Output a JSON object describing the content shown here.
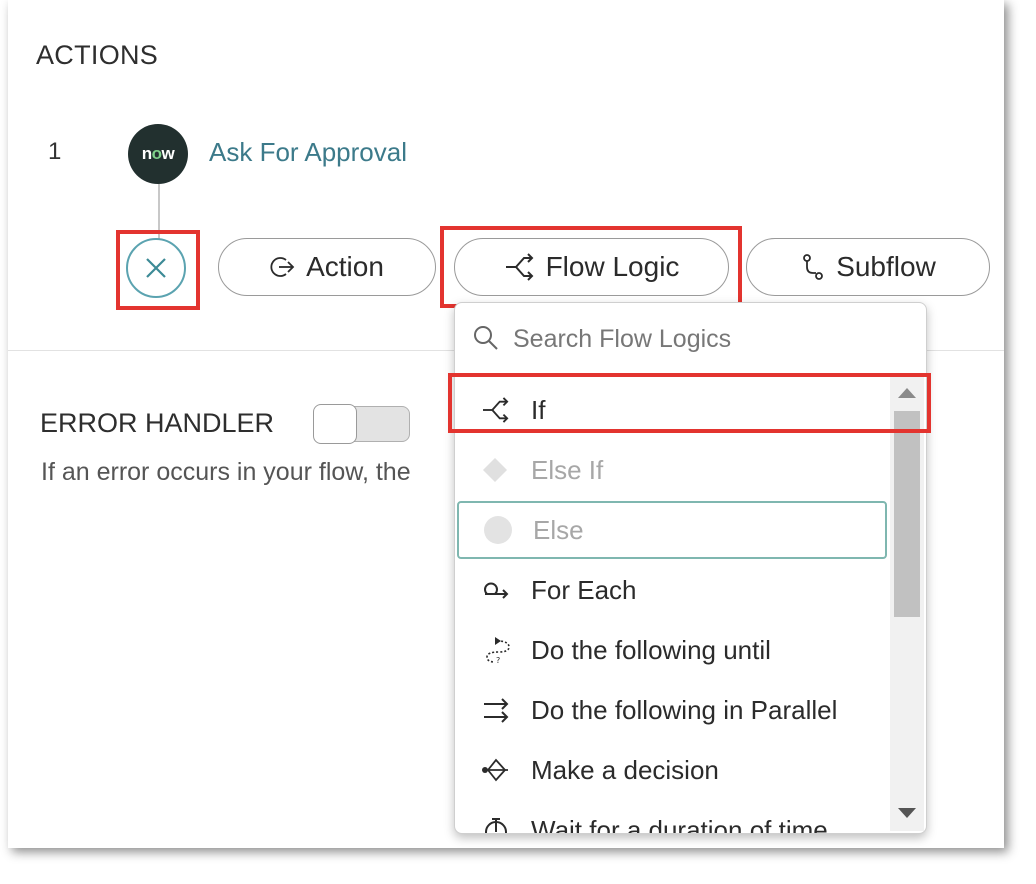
{
  "actions": {
    "title": "ACTIONS",
    "step": {
      "number": "1",
      "logo_text": "now",
      "name": "Ask For Approval"
    },
    "buttons": {
      "action_label": "Action",
      "flow_logic_label": "Flow Logic",
      "subflow_label": "Subflow"
    }
  },
  "error_handler": {
    "title": "ERROR HANDLER",
    "enabled": false,
    "description": "If an error occurs in your flow, the"
  },
  "flow_logic_menu": {
    "search_placeholder": "Search Flow Logics",
    "items": [
      {
        "label": "If",
        "icon": "branch-icon",
        "state": "highlighted"
      },
      {
        "label": "Else If",
        "icon": "diamond-icon",
        "state": "disabled"
      },
      {
        "label": "Else",
        "icon": "circle-icon",
        "state": "disabled-focused"
      },
      {
        "label": "For Each",
        "icon": "loop-icon",
        "state": "normal"
      },
      {
        "label": "Do the following until",
        "icon": "loop-until-icon",
        "state": "normal"
      },
      {
        "label": "Do the following in Parallel",
        "icon": "parallel-arrows-icon",
        "state": "normal"
      },
      {
        "label": "Make a decision",
        "icon": "decision-icon",
        "state": "normal"
      },
      {
        "label": "Wait for a duration of time",
        "icon": "timer-icon",
        "state": "partially-visible"
      }
    ]
  },
  "colors": {
    "highlight": "#e3342f",
    "link": "#3c7a8a",
    "logo_bg": "#22302f"
  }
}
